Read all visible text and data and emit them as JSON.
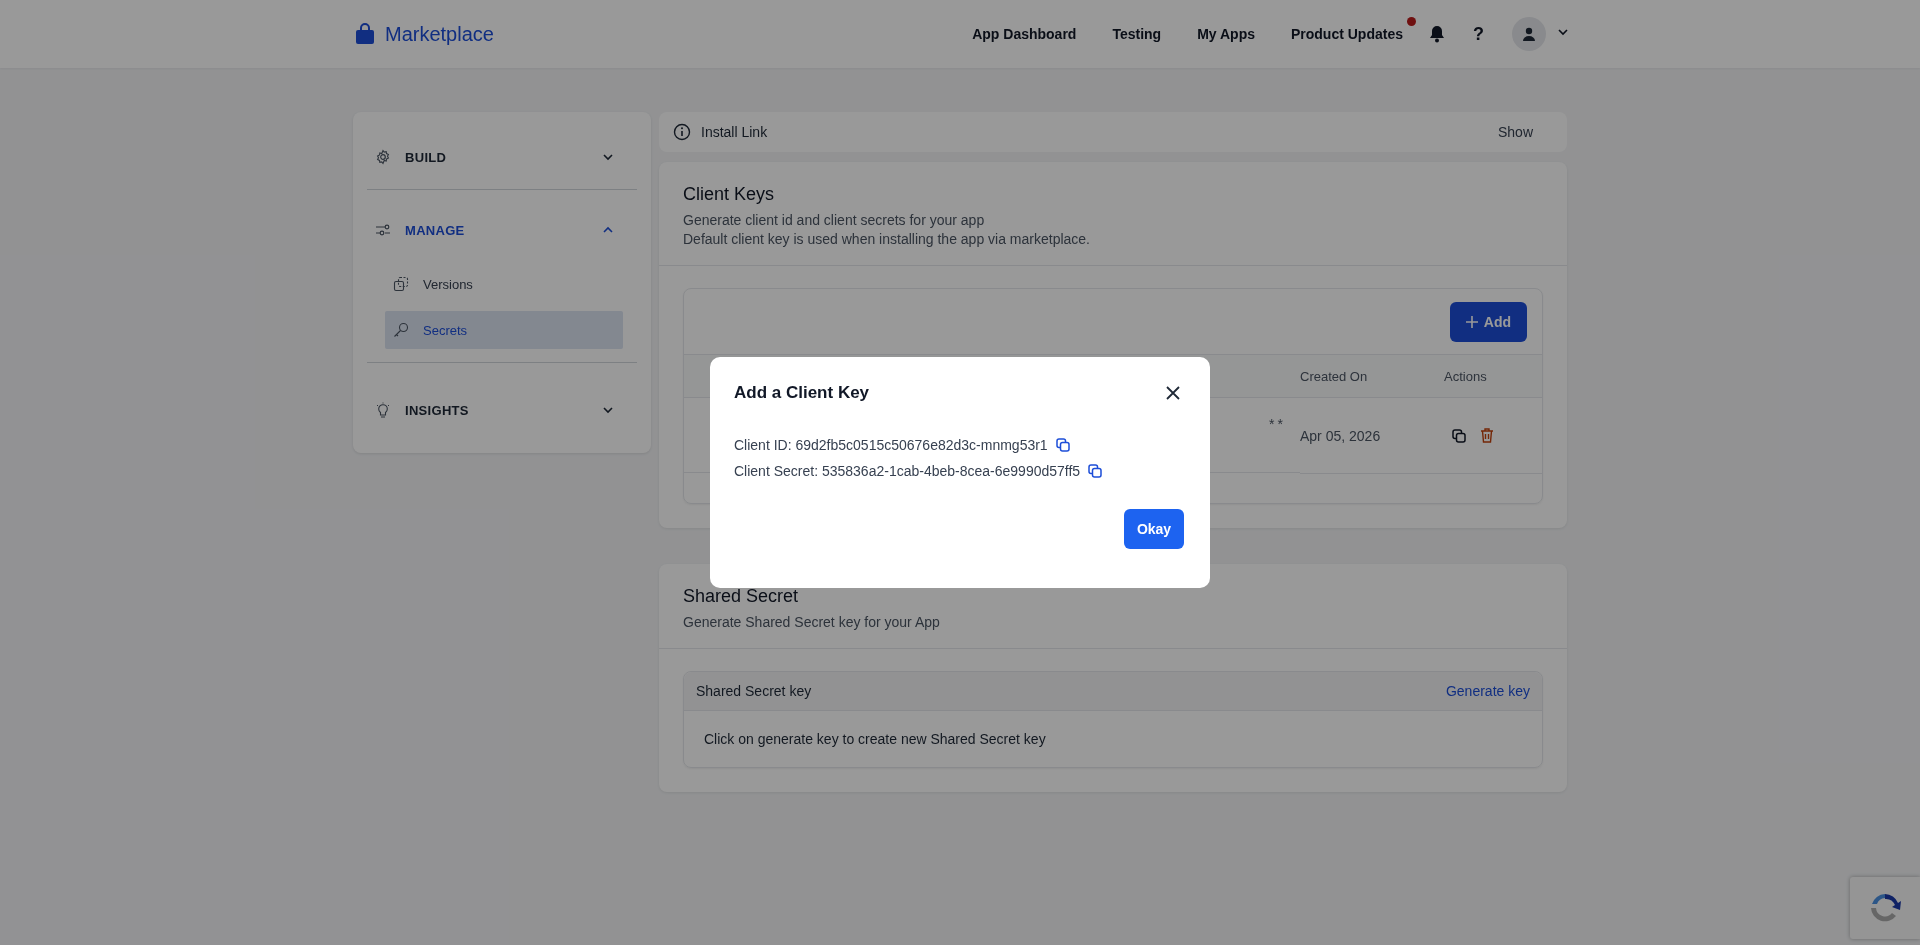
{
  "header": {
    "logo": "Marketplace",
    "nav": [
      {
        "label": "App Dashboard",
        "badge": false
      },
      {
        "label": "Testing",
        "badge": false
      },
      {
        "label": "My Apps",
        "badge": false
      },
      {
        "label": "Product Updates",
        "badge": true
      }
    ],
    "help": "?"
  },
  "sidebar": {
    "sections": [
      {
        "label": "BUILD",
        "expanded": false
      },
      {
        "label": "MANAGE",
        "expanded": true,
        "items": [
          {
            "label": "Versions",
            "selected": false
          },
          {
            "label": "Secrets",
            "selected": true
          }
        ]
      },
      {
        "label": "INSIGHTS",
        "expanded": false
      }
    ]
  },
  "install_link": {
    "label": "Install Link",
    "action": "Show"
  },
  "client_keys": {
    "title": "Client Keys",
    "lines": [
      "Generate client id and client secrets for your app",
      "Default client key is used when installing the app via marketplace."
    ],
    "add_button": "Add",
    "columns": [
      "Created On",
      "Actions"
    ],
    "rows": [
      {
        "secret": "**",
        "created_on": "Apr 05, 2026"
      }
    ]
  },
  "shared_secret": {
    "title": "Shared Secret",
    "subtitle": "Generate Shared Secret key for your App",
    "panel_title": "Shared Secret key",
    "action": "Generate key",
    "message": "Click on generate key to create new Shared Secret key"
  },
  "modal": {
    "title": "Add a Client Key",
    "fields": [
      {
        "label": "Client ID:",
        "value": "69d2fb5c0515c50676e82d3c-mnmg53r1"
      },
      {
        "label": "Client Secret:",
        "value": "535836a2-1cab-4beb-8cea-6e9990d57ff5"
      }
    ],
    "button": "Okay"
  }
}
